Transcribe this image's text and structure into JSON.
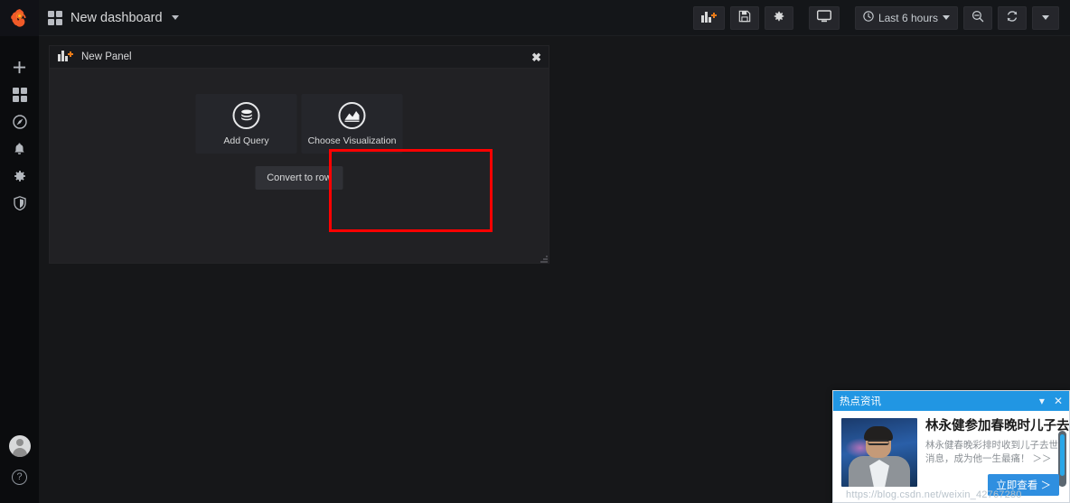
{
  "sidebar": {
    "logo_icon": "grafana-logo-icon",
    "items": [
      {
        "name": "create",
        "icon": "plus-icon"
      },
      {
        "name": "dashboards",
        "icon": "apps-grid-icon"
      },
      {
        "name": "explore",
        "icon": "compass-icon"
      },
      {
        "name": "alerting",
        "icon": "bell-icon"
      },
      {
        "name": "configuration",
        "icon": "gear-icon"
      },
      {
        "name": "server-admin",
        "icon": "shield-icon"
      }
    ],
    "bottom": {
      "avatar_icon": "user-avatar-icon",
      "help_label": "?"
    }
  },
  "topbar": {
    "dashboard_icon": "apps-grid-icon",
    "title": "New dashboard",
    "caret_icon": "chevron-down-icon",
    "buttons": [
      {
        "name": "add-panel",
        "icon": "add-panel-icon",
        "label": ""
      },
      {
        "name": "save-dashboard",
        "icon": "save-floppy-icon",
        "label": ""
      },
      {
        "name": "dashboard-settings",
        "icon": "gear-icon",
        "label": ""
      },
      {
        "name": "cycle-view-mode",
        "icon": "monitor-icon",
        "label": ""
      }
    ],
    "time_picker": {
      "icon": "clock-icon",
      "label": "Last 6 hours",
      "caret_icon": "chevron-down-icon"
    },
    "zoom_out": {
      "icon": "search-minus-icon"
    },
    "refresh": {
      "icon": "refresh-icon"
    },
    "refresh_interval_caret": {
      "icon": "chevron-down-icon"
    }
  },
  "panel": {
    "icon": "add-panel-icon",
    "title": "New Panel",
    "close_label": "✖",
    "actions": [
      {
        "name": "add-query",
        "label": "Add Query",
        "icon": "database-icon"
      },
      {
        "name": "choose-visualization",
        "label": "Choose Visualization",
        "icon": "graph-area-icon"
      }
    ],
    "convert_label": "Convert to row",
    "resize_icon": "resize-grip-icon"
  },
  "annotation": {
    "name": "red-highlight-box",
    "color": "#ff0000"
  },
  "notification": {
    "header_title": "热点资讯",
    "collapse_icon": "chevron-down-icon",
    "close_icon": "close-icon",
    "thumbnail_icon": "news-thumbnail-icon",
    "title": "林永健参加春晚时儿子去世",
    "description": "林永健春晚彩排时收到儿子去世消息，成为他一生最痛！",
    "more_label": "＞＞",
    "cta_label": "立即查看 ＞",
    "accent_color": "#2196e3"
  },
  "watermark": {
    "text": "https://blog.csdn.net/weixin_42767280"
  }
}
